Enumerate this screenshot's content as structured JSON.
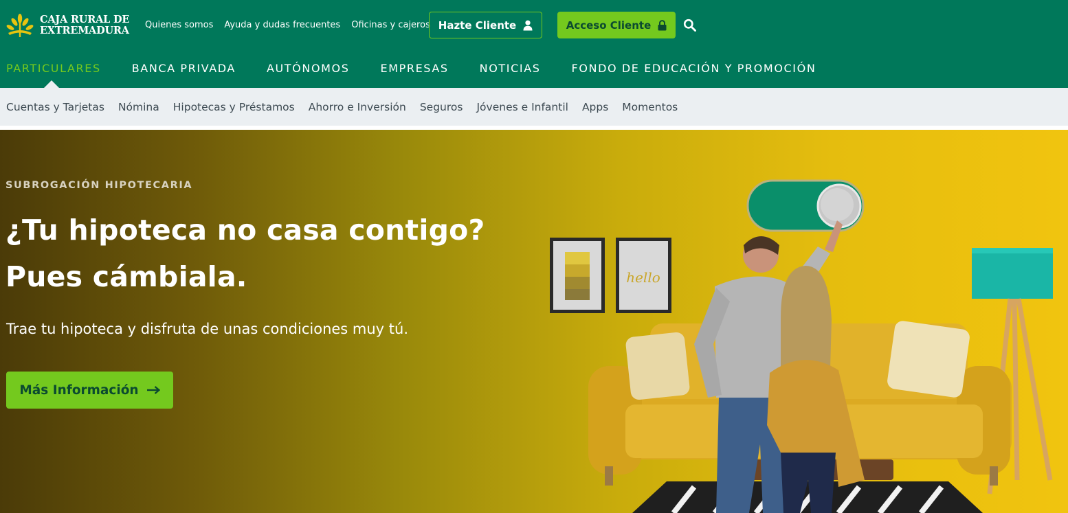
{
  "brand": {
    "line1": "CAJA RURAL DE",
    "line2": "EXTREMADURA",
    "icon": "wheat-sheaf-logo"
  },
  "utility_nav": [
    {
      "label": "Quienes somos"
    },
    {
      "label": "Ayuda y dudas frecuentes"
    },
    {
      "label": "Oficinas y cajeros"
    }
  ],
  "buttons": {
    "hazte_cliente": {
      "label": "Hazte Cliente",
      "icon": "user-icon"
    },
    "acceso_cliente": {
      "label": "Acceso Cliente",
      "icon": "lock-icon"
    },
    "search": {
      "icon": "search-icon"
    }
  },
  "main_nav": [
    {
      "label": "PARTICULARES",
      "active": true
    },
    {
      "label": "BANCA PRIVADA"
    },
    {
      "label": "AUTÓNOMOS"
    },
    {
      "label": "EMPRESAS"
    },
    {
      "label": "NOTICIAS"
    },
    {
      "label": "FONDO DE EDUCACIÓN Y PROMOCIÓN"
    }
  ],
  "sub_nav": [
    {
      "label": "Cuentas y Tarjetas"
    },
    {
      "label": "Nómina"
    },
    {
      "label": "Hipotecas y Préstamos"
    },
    {
      "label": "Ahorro e Inversión"
    },
    {
      "label": "Seguros"
    },
    {
      "label": "Jóvenes e Infantil"
    },
    {
      "label": "Apps"
    },
    {
      "label": "Momentos"
    }
  ],
  "hero": {
    "eyebrow": "SUBROGACIÓN HIPOTECARIA",
    "headline_line1": "¿Tu hipoteca no casa contigo?",
    "headline_line2": "Pues cámbiala.",
    "subtitle": "Trae tu hipoteca y disfruta de unas condiciones muy tú.",
    "cta": {
      "label": "Más Información",
      "icon": "arrow-right-icon"
    },
    "illustration": {
      "frame_text": "hello"
    }
  },
  "colors": {
    "brand_green": "#00785a",
    "accent_green": "#74c91e",
    "subnav_bg": "#ebeff2",
    "hero_yellow": "#f1c40f"
  }
}
